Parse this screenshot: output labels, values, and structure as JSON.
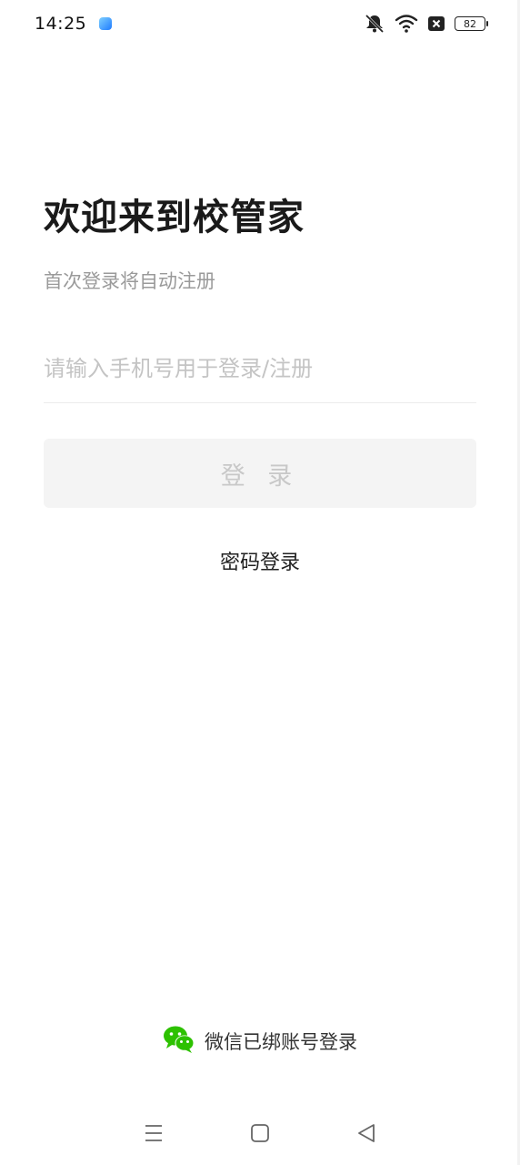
{
  "status_bar": {
    "time": "14:25",
    "battery": "82",
    "icons": [
      "app-icon",
      "mute-icon",
      "wifi-icon",
      "sim-off-icon",
      "battery-icon"
    ]
  },
  "login": {
    "title": "欢迎来到校管家",
    "subtitle": "首次登录将自动注册",
    "phone_placeholder": "请输入手机号用于登录/注册",
    "phone_value": "",
    "login_button": "登 录",
    "password_login": "密码登录"
  },
  "wechat": {
    "label": "微信已绑账号登录",
    "icon": "wechat-icon",
    "color": "#2dc100"
  },
  "nav": {
    "icons": [
      "menu-icon",
      "home-icon",
      "back-icon"
    ]
  }
}
